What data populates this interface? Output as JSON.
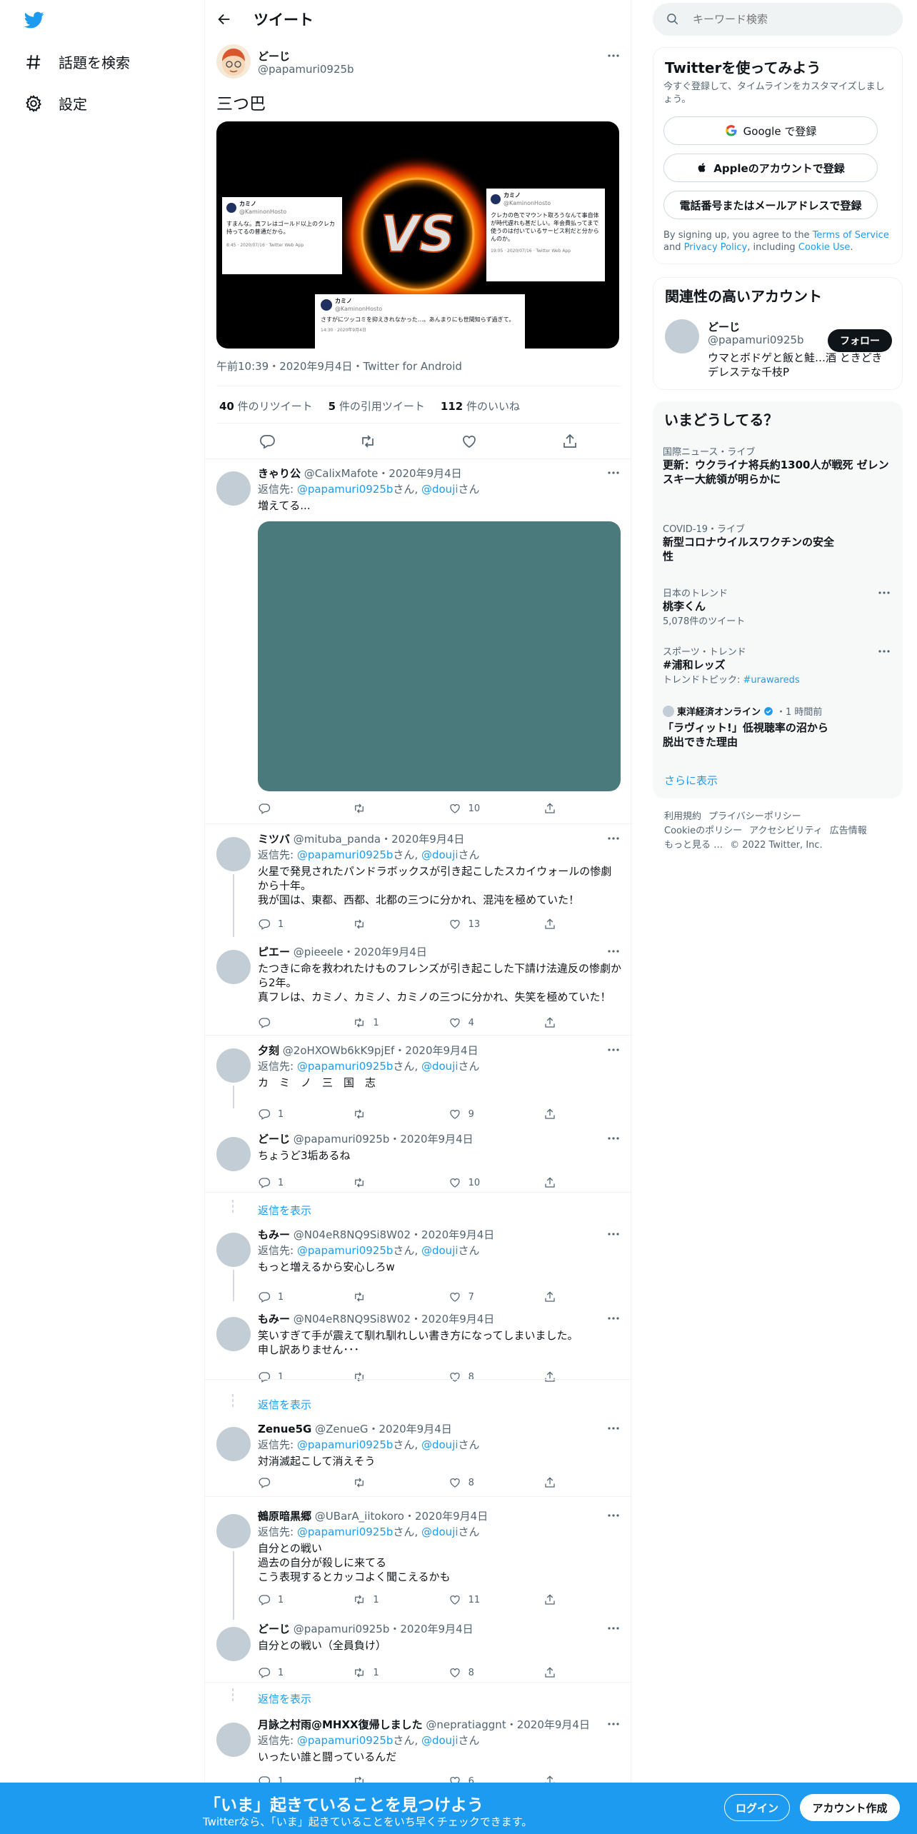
{
  "nav": {
    "explore_label": "話題を検索",
    "settings_label": "設定"
  },
  "header": {
    "title": "ツイート"
  },
  "tweet": {
    "name": "どーじ",
    "handle": "@papamuri0925b",
    "text": "三つ巴",
    "meta": "午前10:39・2020年9月4日・Twitter for Android",
    "retweets_count": "40",
    "retweets_label": "件のリツイート",
    "quotes_count": "5",
    "quotes_label": "件の引用ツイート",
    "likes_count": "112",
    "likes_label": "件のいいね",
    "media": {
      "vs_text": "VS",
      "card1": {
        "name": "カミノ",
        "handle": "@KaminonHosto",
        "text": "すまんな。真フレはゴールド以上のクレカ持ってるの普通だから。",
        "time": "8:45 · 2020/07/16 · Twitter Web App"
      },
      "card2": {
        "name": "カミノ",
        "handle": "@KaminonHosto",
        "text": "クレカの色でマウント取ろうなんて事自体が時代遅れも甚だしい。年会費払ってまで使うのは付いているサービス利だと分からんのか。",
        "time": "19:05 · 2020/07/16 · Twitter Web App"
      },
      "card3": {
        "name": "カミノ",
        "handle": "@KaminonHosto",
        "text": "さすがにツッコミを抑えきれなかった…。あんまりにも世間知らず過ぎて。",
        "time": "14:30 · 2020年9月4日"
      }
    }
  },
  "reply_to_label": "返信先:",
  "san": "さん",
  "show_replies": "返信を表示",
  "replies": [
    {
      "name": "きゃり公",
      "handle": "@CalixMafote",
      "date": "・2020年9月4日",
      "to1": "@papamuri0925b",
      "to2": "@douji",
      "text": "増えてる...",
      "reply": "",
      "rt": "",
      "like": "10"
    },
    {
      "name": "ミツバ",
      "handle": "@mituba_panda",
      "date": "・2020年9月4日",
      "to1": "@papamuri0925b",
      "to2": "@douji",
      "text": "火星で発見されたパンドラボックスが引き起こしたスカイウォールの惨劇から十年。\n我が国は、東都、西都、北都の三つに分かれ、混沌を極めていた！",
      "reply": "1",
      "rt": "",
      "like": "13"
    },
    {
      "name": "ピエー",
      "handle": "@pieeele",
      "date": "・2020年9月4日",
      "text": "たつきに命を救われたけものフレンズが引き起こした下請け法違反の惨劇から2年。\n真フレは、カミノ、カミノ、カミノの三つに分かれ、失笑を極めていた！",
      "reply": "",
      "rt": "1",
      "like": "4"
    },
    {
      "name": "夕刻",
      "handle": "@2oHXOWb6kK9pjEf",
      "date": "・2020年9月4日",
      "to1": "@papamuri0925b",
      "to2": "@douji",
      "text": "カ　ミ　ノ　三　国　志",
      "reply": "1",
      "rt": "",
      "like": "9"
    },
    {
      "name": "どーじ",
      "handle": "@papamuri0925b",
      "date": "・2020年9月4日",
      "text": "ちょうど3垢あるね",
      "reply": "1",
      "rt": "",
      "like": "10"
    },
    {
      "name": "もみー",
      "handle": "@N04eR8NQ9Si8W02",
      "date": "・2020年9月4日",
      "to1": "@papamuri0925b",
      "to2": "@douji",
      "text": "もっと増えるから安心しろw",
      "reply": "1",
      "rt": "",
      "like": "7"
    },
    {
      "name": "もみー",
      "handle": "@N04eR8NQ9Si8W02",
      "date": "・2020年9月4日",
      "text": "笑いすぎて手が震えて馴れ馴れしい書き方になってしまいました。\n申し訳ありません･･･",
      "reply": "1",
      "rt": "",
      "like": "8"
    },
    {
      "name": "Zenue5G",
      "handle": "@ZenueG",
      "date": "・2020年9月4日",
      "to1": "@papamuri0925b",
      "to2": "@douji",
      "text": "対消滅起こして消えそう",
      "reply": "",
      "rt": "",
      "like": "8"
    },
    {
      "name": "鵺原暗黒郷",
      "handle": "@UBarA_iitokoro",
      "date": "・2020年9月4日",
      "to1": "@papamuri0925b",
      "to2": "@douji",
      "text": "自分との戦い\n過去の自分が殺しに来てる\nこう表現するとカッコよく聞こえるかも",
      "reply": "1",
      "rt": "1",
      "like": "11"
    },
    {
      "name": "どーじ",
      "handle": "@papamuri0925b",
      "date": "・2020年9月4日",
      "text": "自分との戦い（全員負け）",
      "reply": "1",
      "rt": "1",
      "like": "8"
    },
    {
      "name": "月詠之村雨@MHXX復帰しました",
      "handle": "@nepratiaggnt",
      "date": "・2020年9月4日",
      "to1": "@papamuri0925b",
      "to2": "@douji",
      "text": "いったい誰と闘っているんだ",
      "reply": "1",
      "rt": "",
      "like": "6"
    }
  ],
  "search": {
    "placeholder": "キーワード検索"
  },
  "signup_card": {
    "title": "Twitterを使ってみよう",
    "subtitle": "今すぐ登録して、タイムラインをカスタマイズしましょう。",
    "google_label": "Google で登録",
    "apple_label": "Appleのアカウントで登録",
    "phone_label": "電話番号またはメールアドレスで登録",
    "terms_pre": "By signing up, you agree to the ",
    "terms_link": "Terms of Service",
    "terms_and": " and ",
    "privacy_link": "Privacy Policy",
    "terms_including": ", including ",
    "cookie_link": "Cookie Use",
    "terms_end": "."
  },
  "related": {
    "title": "関連性の高いアカウント",
    "name": "どーじ",
    "handle": "@papamuri0925b",
    "bio": "ウマとボドゲと飯と鮭…酒 ときどきデレステな千枝P",
    "follow_label": "フォロー"
  },
  "trends": {
    "title": "いまどうしてる？",
    "items": [
      {
        "category": "国際ニュース・ライブ",
        "title": "更新：ウクライナ将兵約1300人が戦死 ゼレンスキー大統領が明らかに"
      },
      {
        "category": "COVID-19・ライブ",
        "title": "新型コロナウイルスワクチンの安全性"
      },
      {
        "category": "日本のトレンド",
        "title": "桃李くん",
        "sub": "5,078件のツイート"
      },
      {
        "category": "スポーツ・トレンド",
        "title": "#浦和レッズ",
        "sub_pre": "トレンドトピック: ",
        "sub_link": "#urawareds"
      },
      {
        "category": "東洋経済オンライン",
        "time": "・1 時間前",
        "title": "「ラヴィット!」低視聴率の沼から脱出できた理由"
      }
    ],
    "show_more": "さらに表示"
  },
  "footer": {
    "terms": "利用規約",
    "privacy": "プライバシーポリシー",
    "cookie": "Cookieのポリシー",
    "accessibility": "アクセシビリティ",
    "ads": "広告情報",
    "more": "もっと見る …",
    "copyright": "© 2022 Twitter, Inc."
  },
  "bottombar": {
    "title": "「いま」起きていることを見つけよう",
    "subtitle": "Twitterなら、「いま」起きていることをいち早くチェックできます。",
    "login_label": "ログイン",
    "signup_label": "アカウント作成"
  },
  "colors": {
    "accent": "#1d9bf0",
    "text": "#0f1419",
    "secondary": "#536471",
    "media_placeholder": "#4a7a7c"
  }
}
